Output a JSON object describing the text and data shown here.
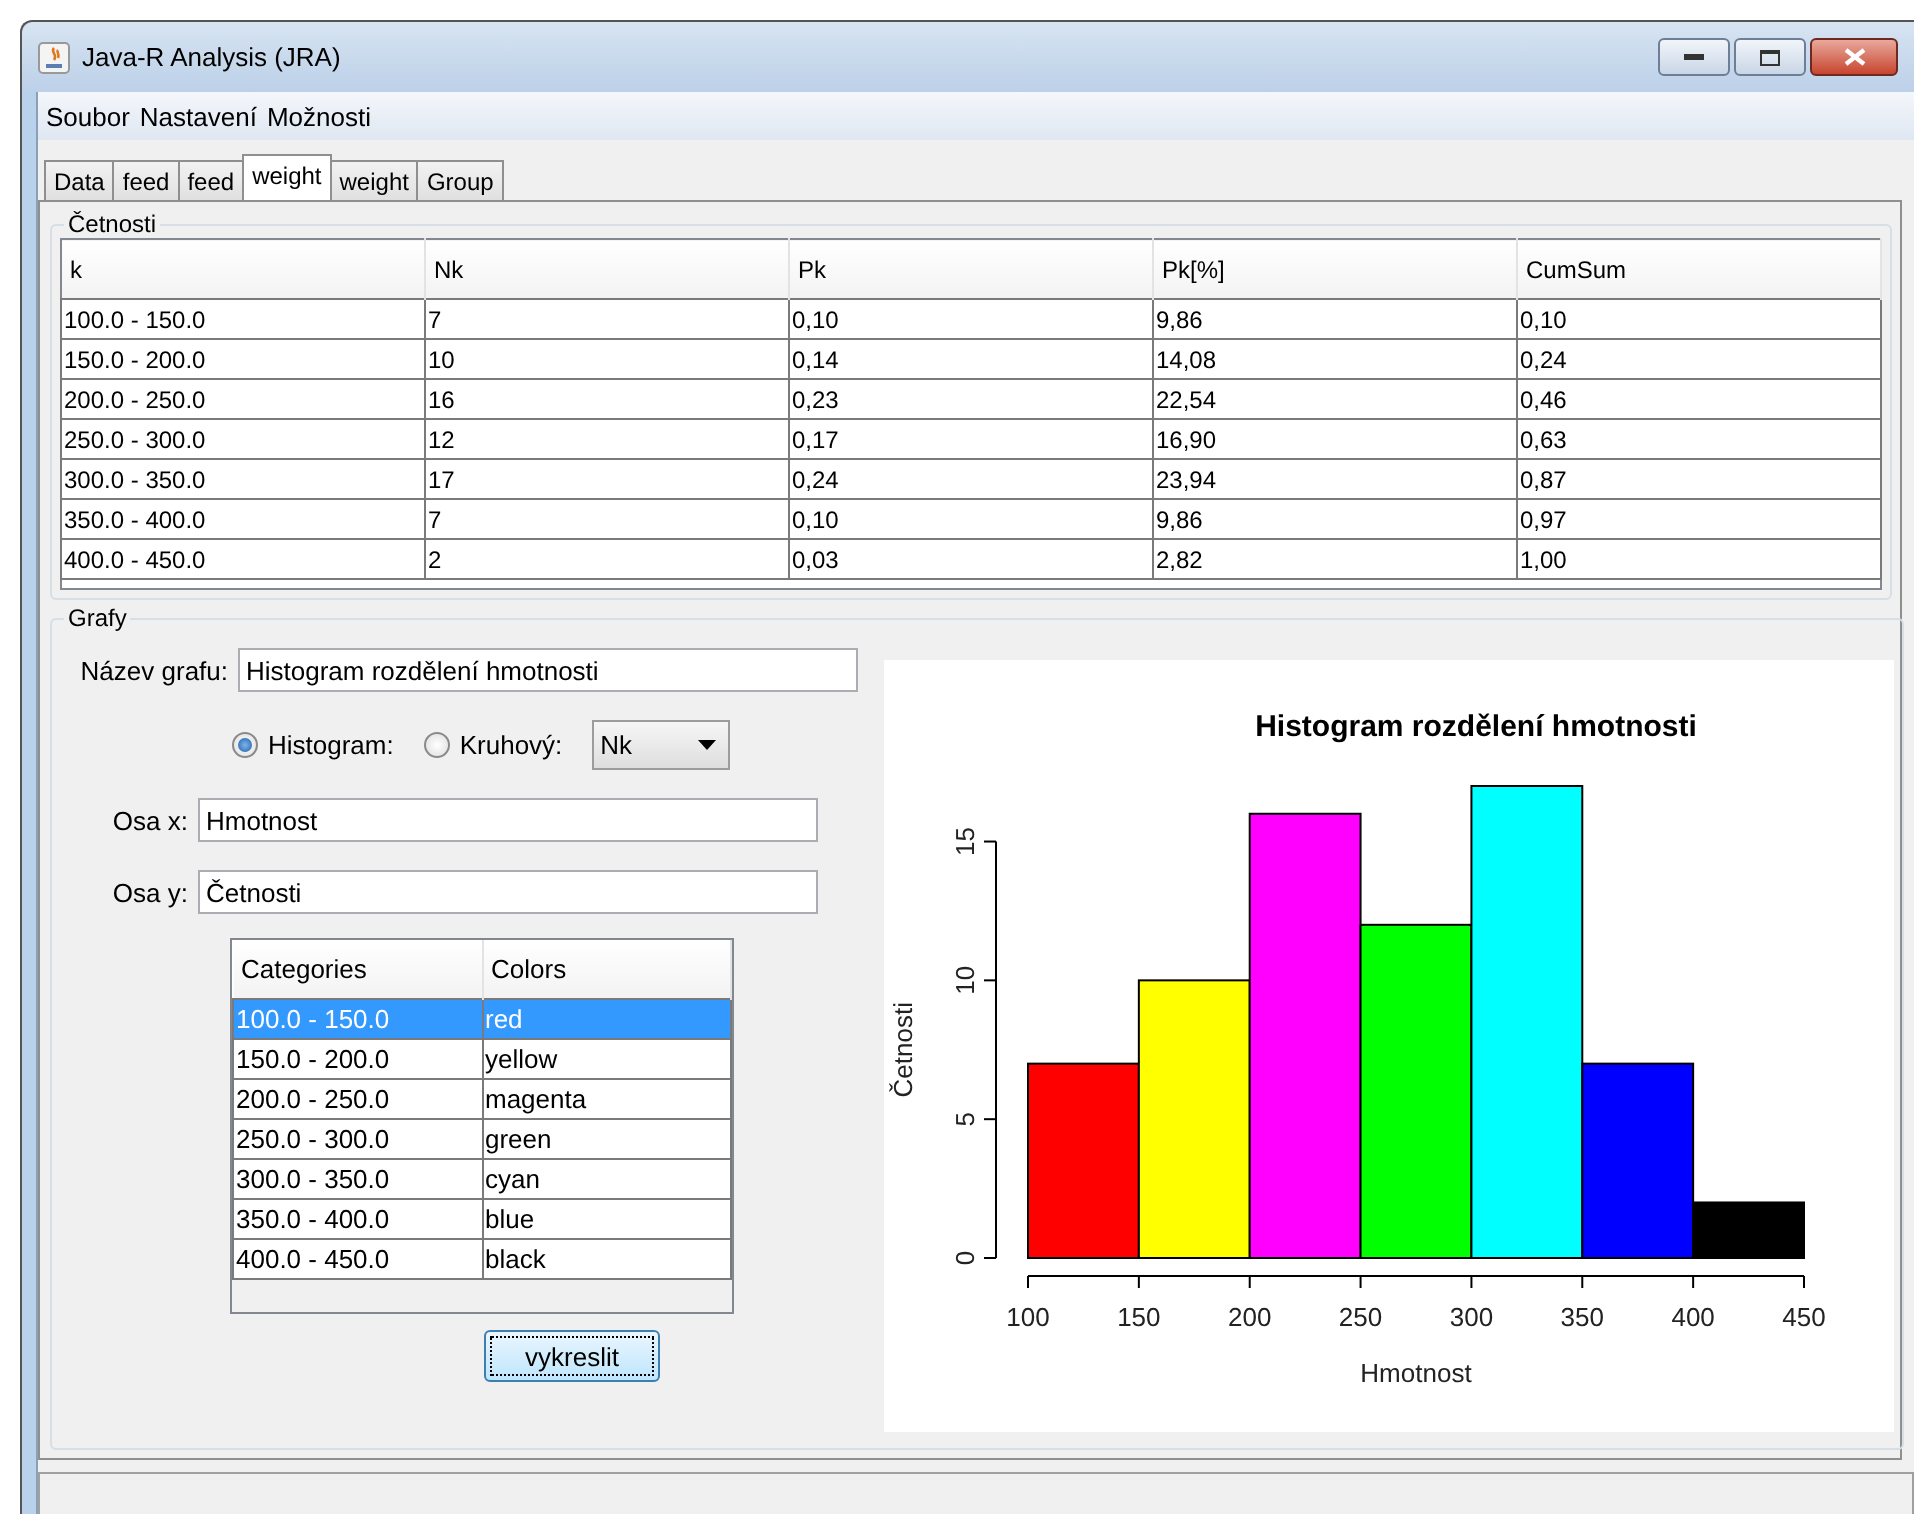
{
  "window": {
    "title": "Java-R Analysis (JRA)"
  },
  "menu": [
    "Soubor",
    "Nastavení",
    "Možnosti"
  ],
  "tabs": [
    {
      "label": "Data",
      "selected": false
    },
    {
      "label": "feed",
      "selected": false
    },
    {
      "label": "feed",
      "selected": false
    },
    {
      "label": "weight",
      "selected": true
    },
    {
      "label": "weight",
      "selected": false
    },
    {
      "label": "Group",
      "selected": false
    }
  ],
  "frequency_panel": {
    "title": "Četnosti",
    "columns": [
      "k",
      "Nk",
      "Pk",
      "Pk[%]",
      "CumSum"
    ],
    "rows": [
      [
        "100.0 - 150.0",
        "7",
        "0,10",
        "9,86",
        "0,10"
      ],
      [
        "150.0 - 200.0",
        "10",
        "0,14",
        "14,08",
        "0,24"
      ],
      [
        "200.0 - 250.0",
        "16",
        "0,23",
        "22,54",
        "0,46"
      ],
      [
        "250.0 - 300.0",
        "12",
        "0,17",
        "16,90",
        "0,63"
      ],
      [
        "300.0 - 350.0",
        "17",
        "0,24",
        "23,94",
        "0,87"
      ],
      [
        "350.0 - 400.0",
        "7",
        "0,10",
        "9,86",
        "0,97"
      ],
      [
        "400.0 - 450.0",
        "2",
        "0,03",
        "2,82",
        "1,00"
      ]
    ]
  },
  "charts_panel": {
    "title": "Grafy",
    "chart_title_field": {
      "label": "Název grafu:",
      "value": "Histogram rozdělení hmotnosti"
    },
    "chart_type": [
      {
        "label": "Histogram:",
        "selected": true
      },
      {
        "label": "Kruhový:",
        "selected": false
      }
    ],
    "variable_dropdown": {
      "value": "Nk"
    },
    "x_axis_field": {
      "label": "Osa x:",
      "value": "Hmotnost"
    },
    "y_axis_field": {
      "label": "Osa y:",
      "value": "Četnosti"
    },
    "colors_table": {
      "columns": [
        "Categories",
        "Colors"
      ],
      "rows": [
        {
          "category": "100.0 - 150.0",
          "color_name": "red",
          "selected": true
        },
        {
          "category": "150.0 - 200.0",
          "color_name": "yellow",
          "selected": false
        },
        {
          "category": "200.0 - 250.0",
          "color_name": "magenta",
          "selected": false
        },
        {
          "category": "250.0 - 300.0",
          "color_name": "green",
          "selected": false
        },
        {
          "category": "300.0 - 350.0",
          "color_name": "cyan",
          "selected": false
        },
        {
          "category": "350.0 - 400.0",
          "color_name": "blue",
          "selected": false
        },
        {
          "category": "400.0 - 450.0",
          "color_name": "black",
          "selected": false
        }
      ]
    },
    "draw_button": "vykreslit",
    "chart_data": {
      "type": "bar",
      "title": "Histogram rozdělení hmotnosti",
      "xlabel": "Hmotnost",
      "ylabel": "Četnosti",
      "x": [
        125,
        175,
        225,
        275,
        325,
        375,
        425
      ],
      "values": [
        7,
        10,
        16,
        12,
        17,
        7,
        2
      ],
      "colors": [
        "#ff0000",
        "#ffff00",
        "#ff00ff",
        "#00ff00",
        "#00ffff",
        "#0000ff",
        "#000000"
      ],
      "xlim": [
        100,
        450
      ],
      "ylim": [
        0,
        17
      ],
      "xticks": [
        100,
        150,
        200,
        250,
        300,
        350,
        400,
        450
      ],
      "yticks": [
        0,
        5,
        10,
        15
      ]
    }
  }
}
